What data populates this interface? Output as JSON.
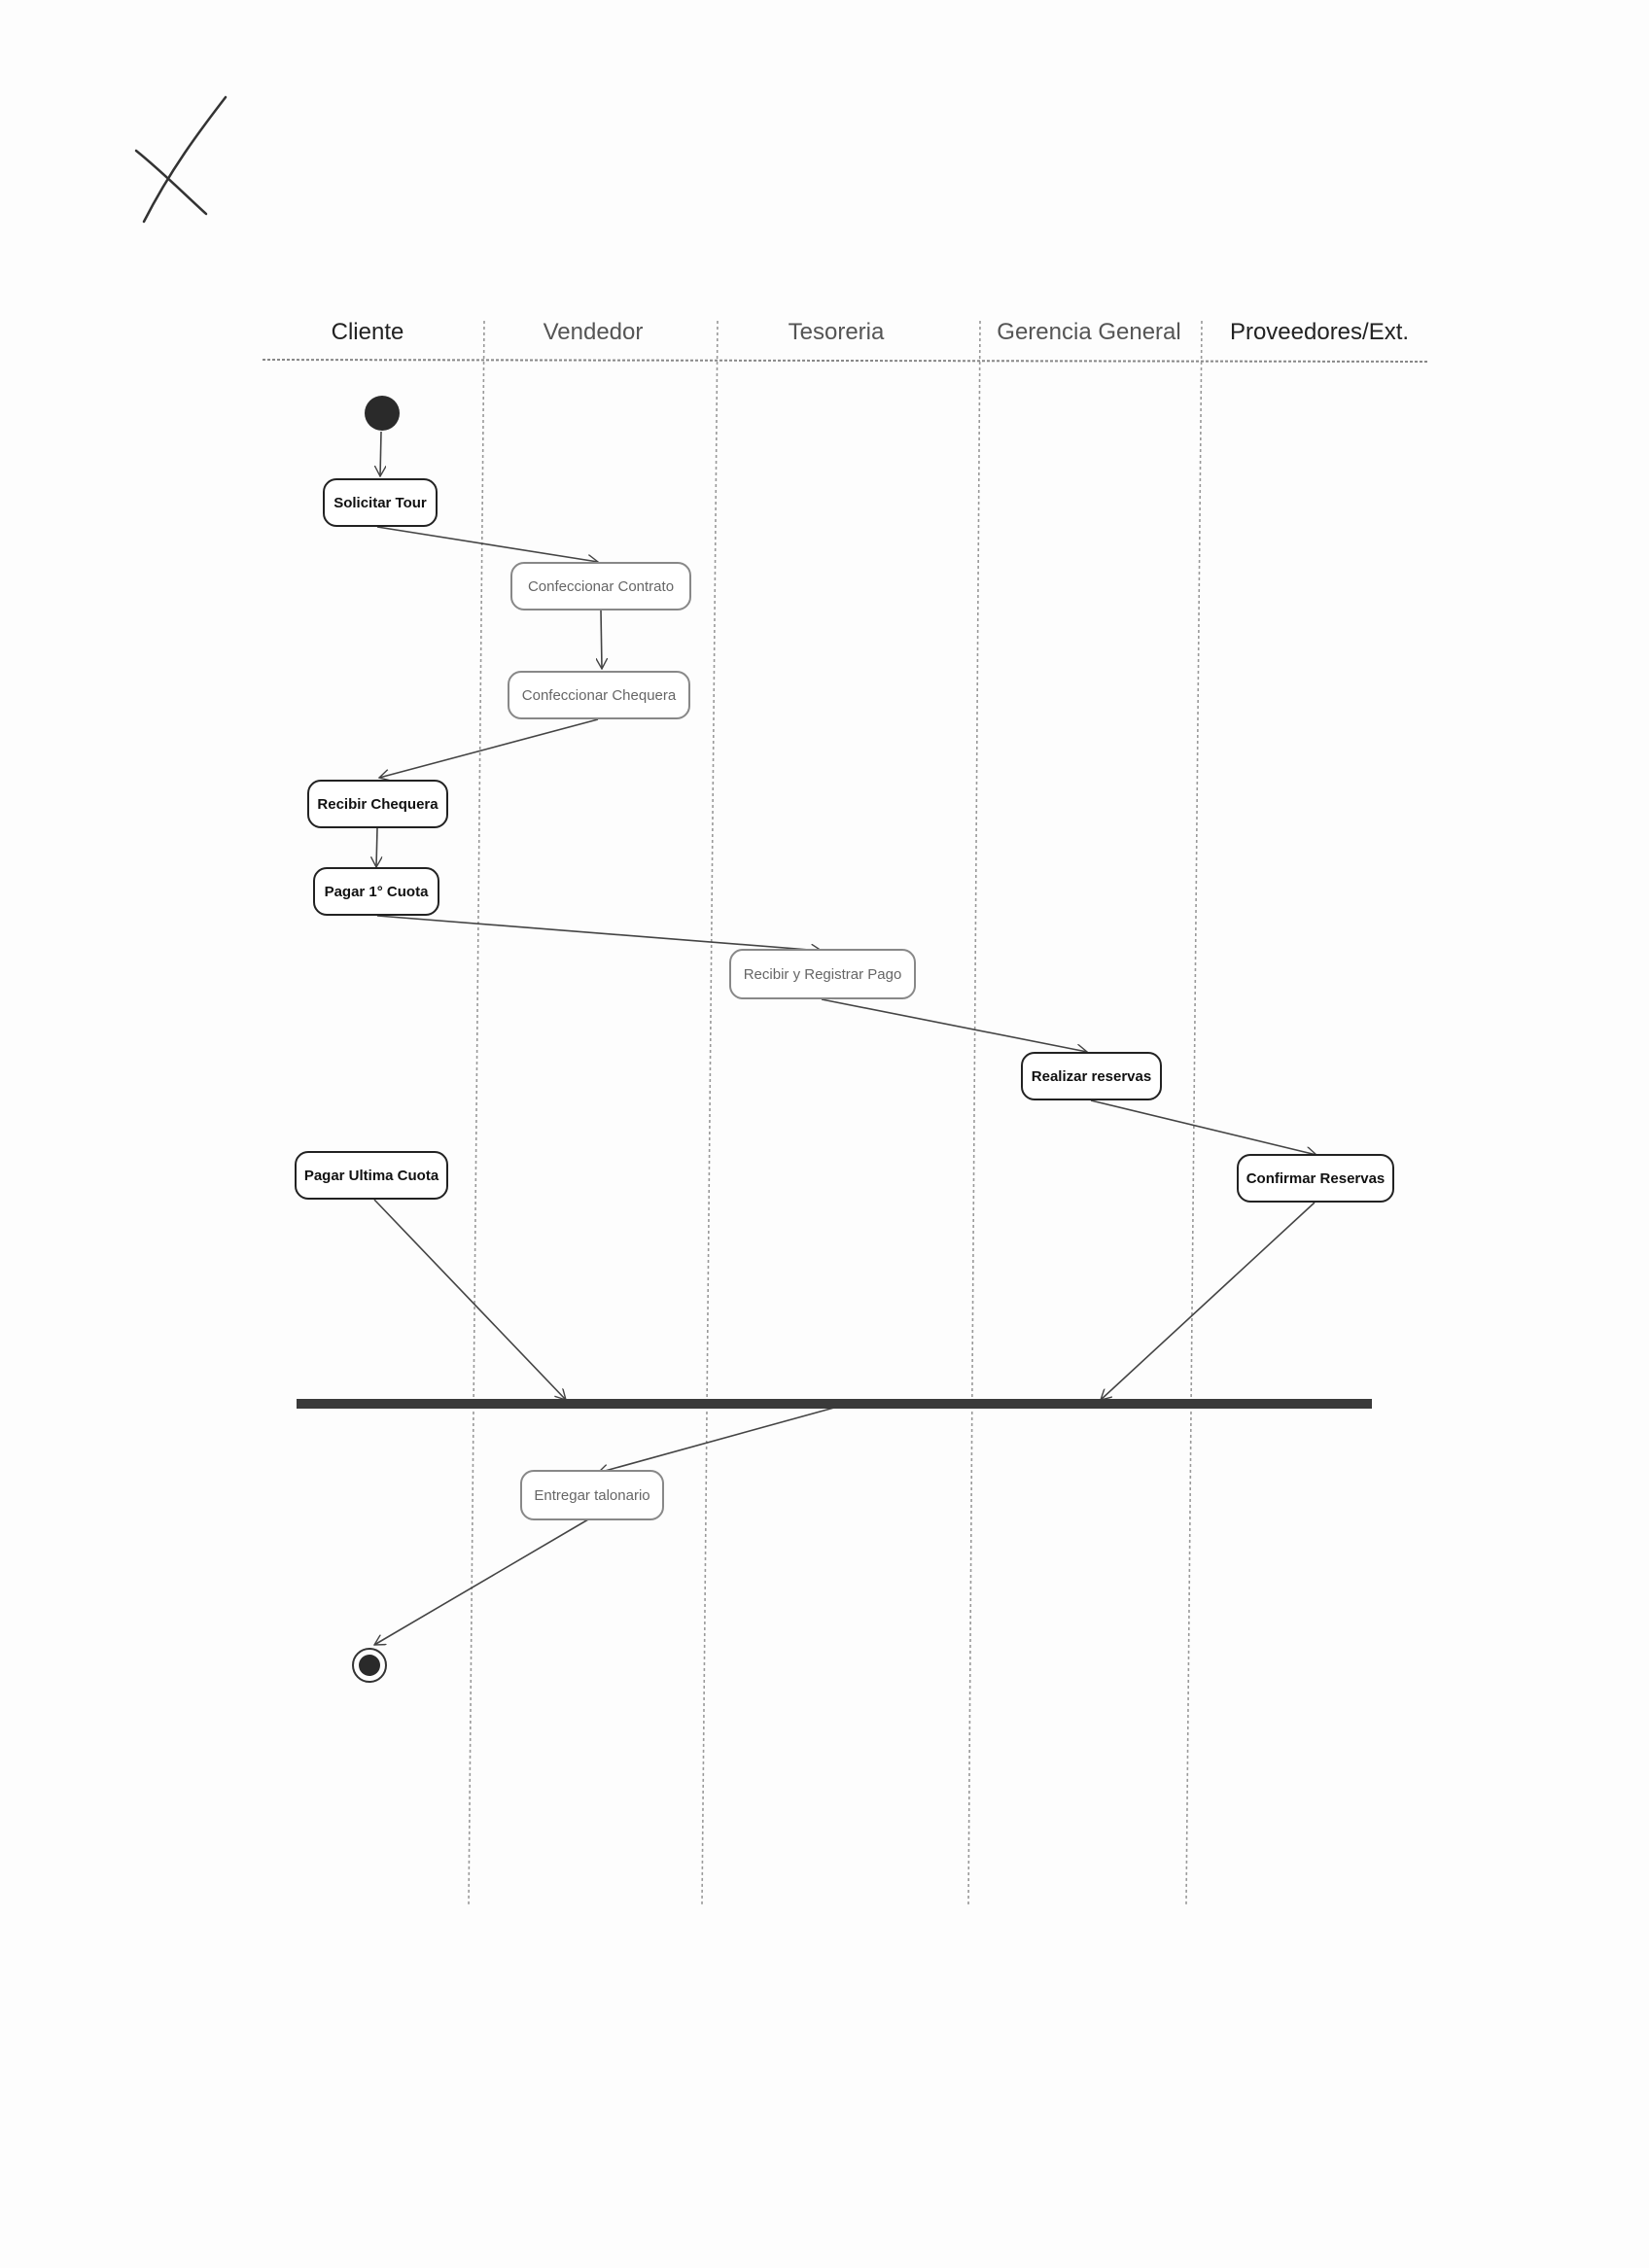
{
  "lanes": [
    "Cliente",
    "Vendedor",
    "Tesoreria",
    "Gerencia General",
    "Proveedores/Ext."
  ],
  "activities": {
    "solicitar_tour": "Solicitar Tour",
    "confeccionar_contrato": "Confeccionar Contrato",
    "confeccionar_chequera": "Confeccionar Chequera",
    "recibir_chequera": "Recibir Chequera",
    "pagar_1_cuota": "Pagar 1° Cuota",
    "recibir_registrar_pago": "Recibir y Registrar Pago",
    "realizar_reservas": "Realizar reservas",
    "pagar_ultima_cuota": "Pagar Ultima Cuota",
    "confirmar_reservas": "Confirmar Reservas",
    "entregar_talonario": "Entregar talonario"
  },
  "colors": {
    "ink": "#333333",
    "bar": "#3a3a3a",
    "dot": "#2a2a2a"
  }
}
